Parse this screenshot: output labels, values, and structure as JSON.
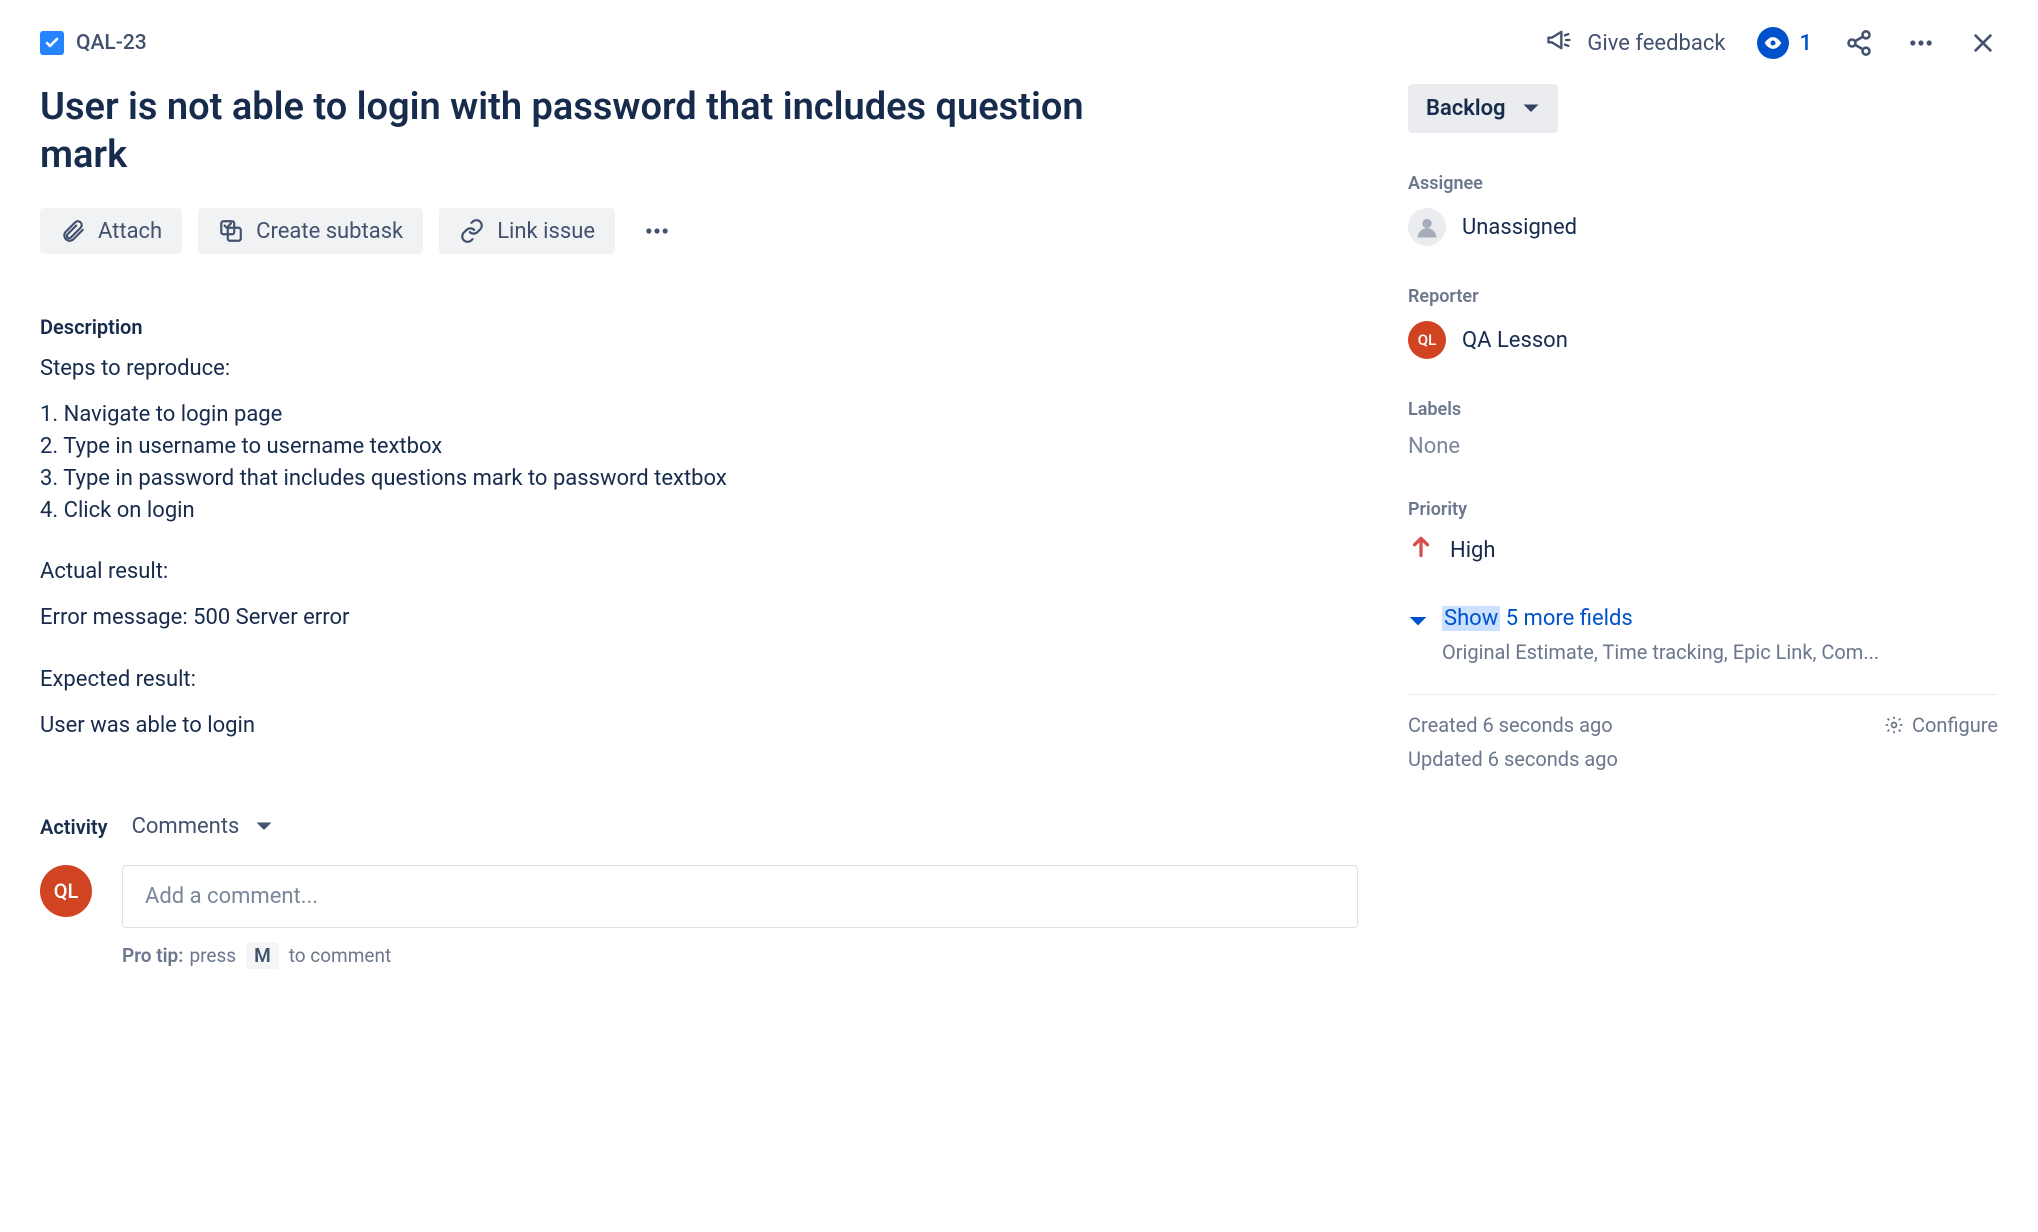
{
  "header": {
    "issue_key": "QAL-23",
    "feedback": "Give feedback",
    "watch_count": "1"
  },
  "title": "User is not able to login with password that includes question mark",
  "actions": {
    "attach": "Attach",
    "subtask": "Create subtask",
    "link": "Link issue"
  },
  "description": {
    "label": "Description",
    "steps_heading": "Steps to reproduce:",
    "steps": [
      "1. Navigate to login page",
      "2. Type in username to username textbox",
      "3. Type in password that includes questions mark to password textbox",
      "4. Click on login"
    ],
    "actual_heading": "Actual result:",
    "actual_body": "Error message: 500 Server error",
    "expected_heading": "Expected result:",
    "expected_body": "User was able to login"
  },
  "activity": {
    "label": "Activity",
    "tab": "Comments",
    "placeholder": "Add a comment...",
    "protip_prefix": "Pro tip:",
    "protip_mid": "press",
    "protip_key": "M",
    "protip_suffix": "to comment",
    "avatar_initials": "QL"
  },
  "sidebar": {
    "status": "Backlog",
    "assignee_label": "Assignee",
    "assignee_value": "Unassigned",
    "reporter_label": "Reporter",
    "reporter_value": "QA Lesson",
    "reporter_initials": "QL",
    "labels_label": "Labels",
    "labels_value": "None",
    "priority_label": "Priority",
    "priority_value": "High",
    "show_more_hl": "Show",
    "show_more_rest": " 5 more fields",
    "show_more_sub": "Original Estimate, Time tracking, Epic Link, Com...",
    "created": "Created 6 seconds ago",
    "updated": "Updated 6 seconds ago",
    "configure": "Configure"
  }
}
